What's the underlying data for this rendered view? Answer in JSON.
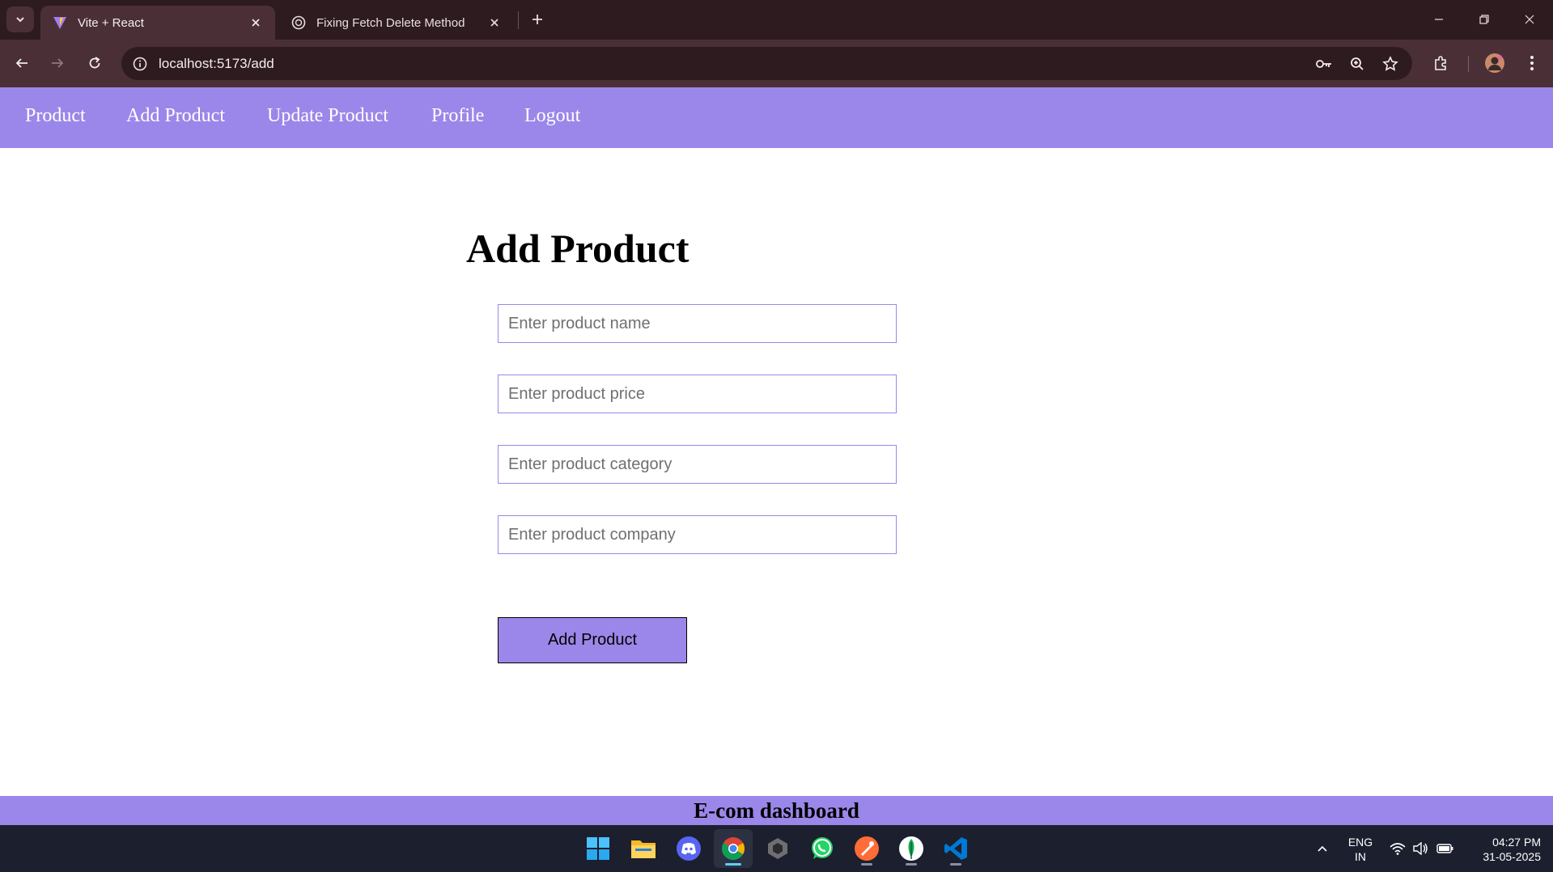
{
  "browser": {
    "tabs": [
      {
        "title": "Vite + React",
        "favicon": "vite-logo",
        "active": true
      },
      {
        "title": "Fixing Fetch Delete Method",
        "favicon": "openai-logo",
        "active": false
      }
    ],
    "url": "localhost:5173/add"
  },
  "nav": {
    "items": [
      {
        "label": "Product"
      },
      {
        "label": "Add Product"
      },
      {
        "label": "Update Product"
      },
      {
        "label": "Profile"
      },
      {
        "label": "Logout"
      }
    ]
  },
  "form": {
    "title": "Add Product",
    "fields": [
      {
        "placeholder": "Enter product name",
        "value": ""
      },
      {
        "placeholder": "Enter product price",
        "value": ""
      },
      {
        "placeholder": "Enter product category",
        "value": ""
      },
      {
        "placeholder": "Enter product company",
        "value": ""
      }
    ],
    "submit_label": "Add Product"
  },
  "footer": {
    "text": "E-com dashboard"
  },
  "taskbar": {
    "apps": [
      "windows-start",
      "file-explorer",
      "discord",
      "chrome",
      "github-desktop",
      "whatsapp",
      "postman",
      "mongodb-compass",
      "vscode"
    ],
    "lang_line1": "ENG",
    "lang_line2": "IN",
    "time": "04:27 PM",
    "date": "31-05-2025"
  },
  "colors": {
    "accent": "#9b87e9",
    "chrome_dark": "#2e1b20",
    "chrome_toolbar": "#4a3036",
    "taskbar": "#1c1f2e"
  }
}
